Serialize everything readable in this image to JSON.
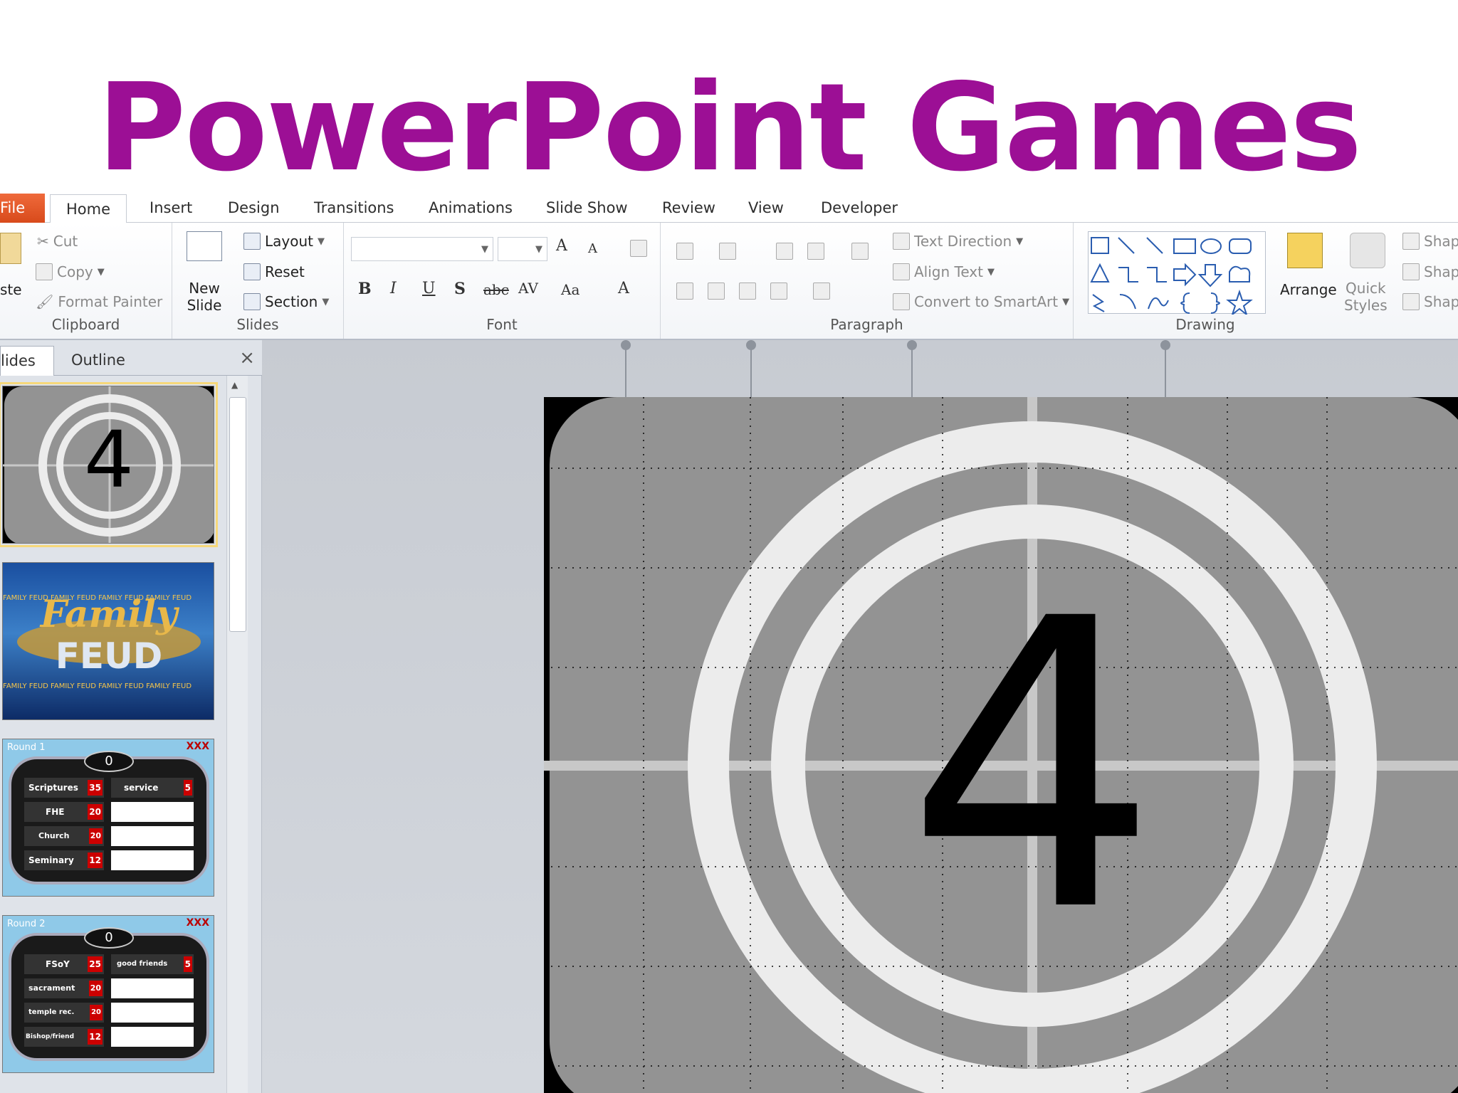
{
  "banner": {
    "title": "PowerPoint Games"
  },
  "tabs": {
    "file": "File",
    "home": "Home",
    "insert": "Insert",
    "design": "Design",
    "transitions": "Transitions",
    "animations": "Animations",
    "slideshow": "Slide Show",
    "review": "Review",
    "view": "View",
    "developer": "Developer"
  },
  "clipboard": {
    "paste": "ste",
    "cut": "Cut",
    "copy": "Copy",
    "format_painter": "Format Painter",
    "label": "Clipboard"
  },
  "slides_group": {
    "new_slide_line1": "New",
    "new_slide_line2": "Slide",
    "layout": "Layout",
    "reset": "Reset",
    "section": "Section",
    "label": "Slides"
  },
  "font_group": {
    "label": "Font",
    "bold": "B",
    "italic": "I",
    "underline": "U",
    "shadow": "S",
    "strike": "abc",
    "spacing": "AV",
    "case": "Aa",
    "color": "A",
    "grow": "A",
    "shrink": "A"
  },
  "paragraph_group": {
    "label": "Paragraph",
    "text_direction": "Text Direction",
    "align_text": "Align Text",
    "convert_smartart": "Convert to SmartArt"
  },
  "drawing_group": {
    "label": "Drawing",
    "arrange": "Arrange",
    "quick_styles_line1": "Quick",
    "quick_styles_line2": "Styles",
    "shape1": "Shap",
    "shape2": "Shap",
    "shape3": "Shap"
  },
  "panel": {
    "slides_tab": "lides",
    "outline_tab": "Outline",
    "close": "×"
  },
  "thumbnails": {
    "countdown_number": "4",
    "feud_title_1": "Family",
    "feud_title_2": "FEUD",
    "feud_strip": "FAMILY FEUD FAMILY FEUD FAMILY FEUD FAMILY FEUD",
    "round1": {
      "round": "Round 1",
      "score": "0",
      "strikes": "XXX",
      "answers": [
        {
          "text": "Scriptures",
          "pts": "35"
        },
        {
          "text": "FHE",
          "pts": "20"
        },
        {
          "text": "Church",
          "pts": "20"
        },
        {
          "text": "Seminary",
          "pts": "12"
        }
      ],
      "answer_right": {
        "text": "service",
        "pts": "5"
      }
    },
    "round2": {
      "round": "Round 2",
      "score": "0",
      "strikes": "XXX",
      "answers": [
        {
          "text": "FSoY",
          "pts": "25"
        },
        {
          "text": "sacrament",
          "pts": "20"
        },
        {
          "text": "temple rec.",
          "pts": "20"
        },
        {
          "text": "Bishop/friend",
          "pts": "12"
        }
      ],
      "answer_right": {
        "text": "good friends",
        "pts": "5"
      }
    }
  },
  "main_slide": {
    "number": "4"
  },
  "colors": {
    "accent_title": "#9c0f95",
    "file_tab": "#e45a2a",
    "slide_gray": "#939393",
    "ring": "#ececec"
  }
}
